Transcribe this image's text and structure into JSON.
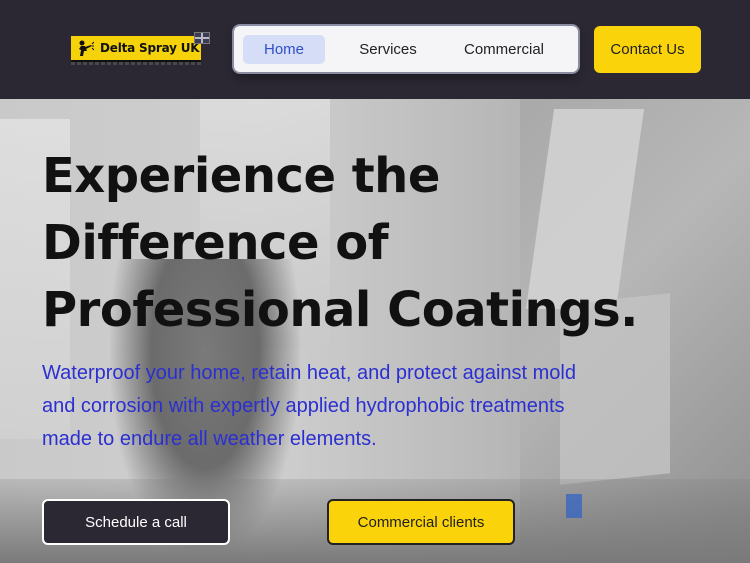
{
  "header": {
    "logo_text": "Delta Spray UK"
  },
  "nav": {
    "items": [
      {
        "label": "Home",
        "active": true
      },
      {
        "label": "Services",
        "active": false
      },
      {
        "label": "Commercial",
        "active": false
      }
    ],
    "contact_label": "Contact Us"
  },
  "hero": {
    "title_lines": [
      "Experience the",
      "Difference of",
      "Professional Coatings."
    ],
    "subtitle_lines": [
      "Waterproof your home, retain heat, and protect against mold",
      "and corrosion with expertly applied hydrophobic treatments",
      "made to endure all weather elements."
    ],
    "primary_button": "Schedule a call",
    "secondary_button": "Commercial clients"
  },
  "colors": {
    "header_bg": "#2b2834",
    "accent_yellow": "#fad30a",
    "subtitle_blue": "#2b2fd1",
    "nav_active_bg": "#d6ddf6"
  },
  "icons": [
    "logo-spray-icon",
    "uk-flag-icon"
  ]
}
